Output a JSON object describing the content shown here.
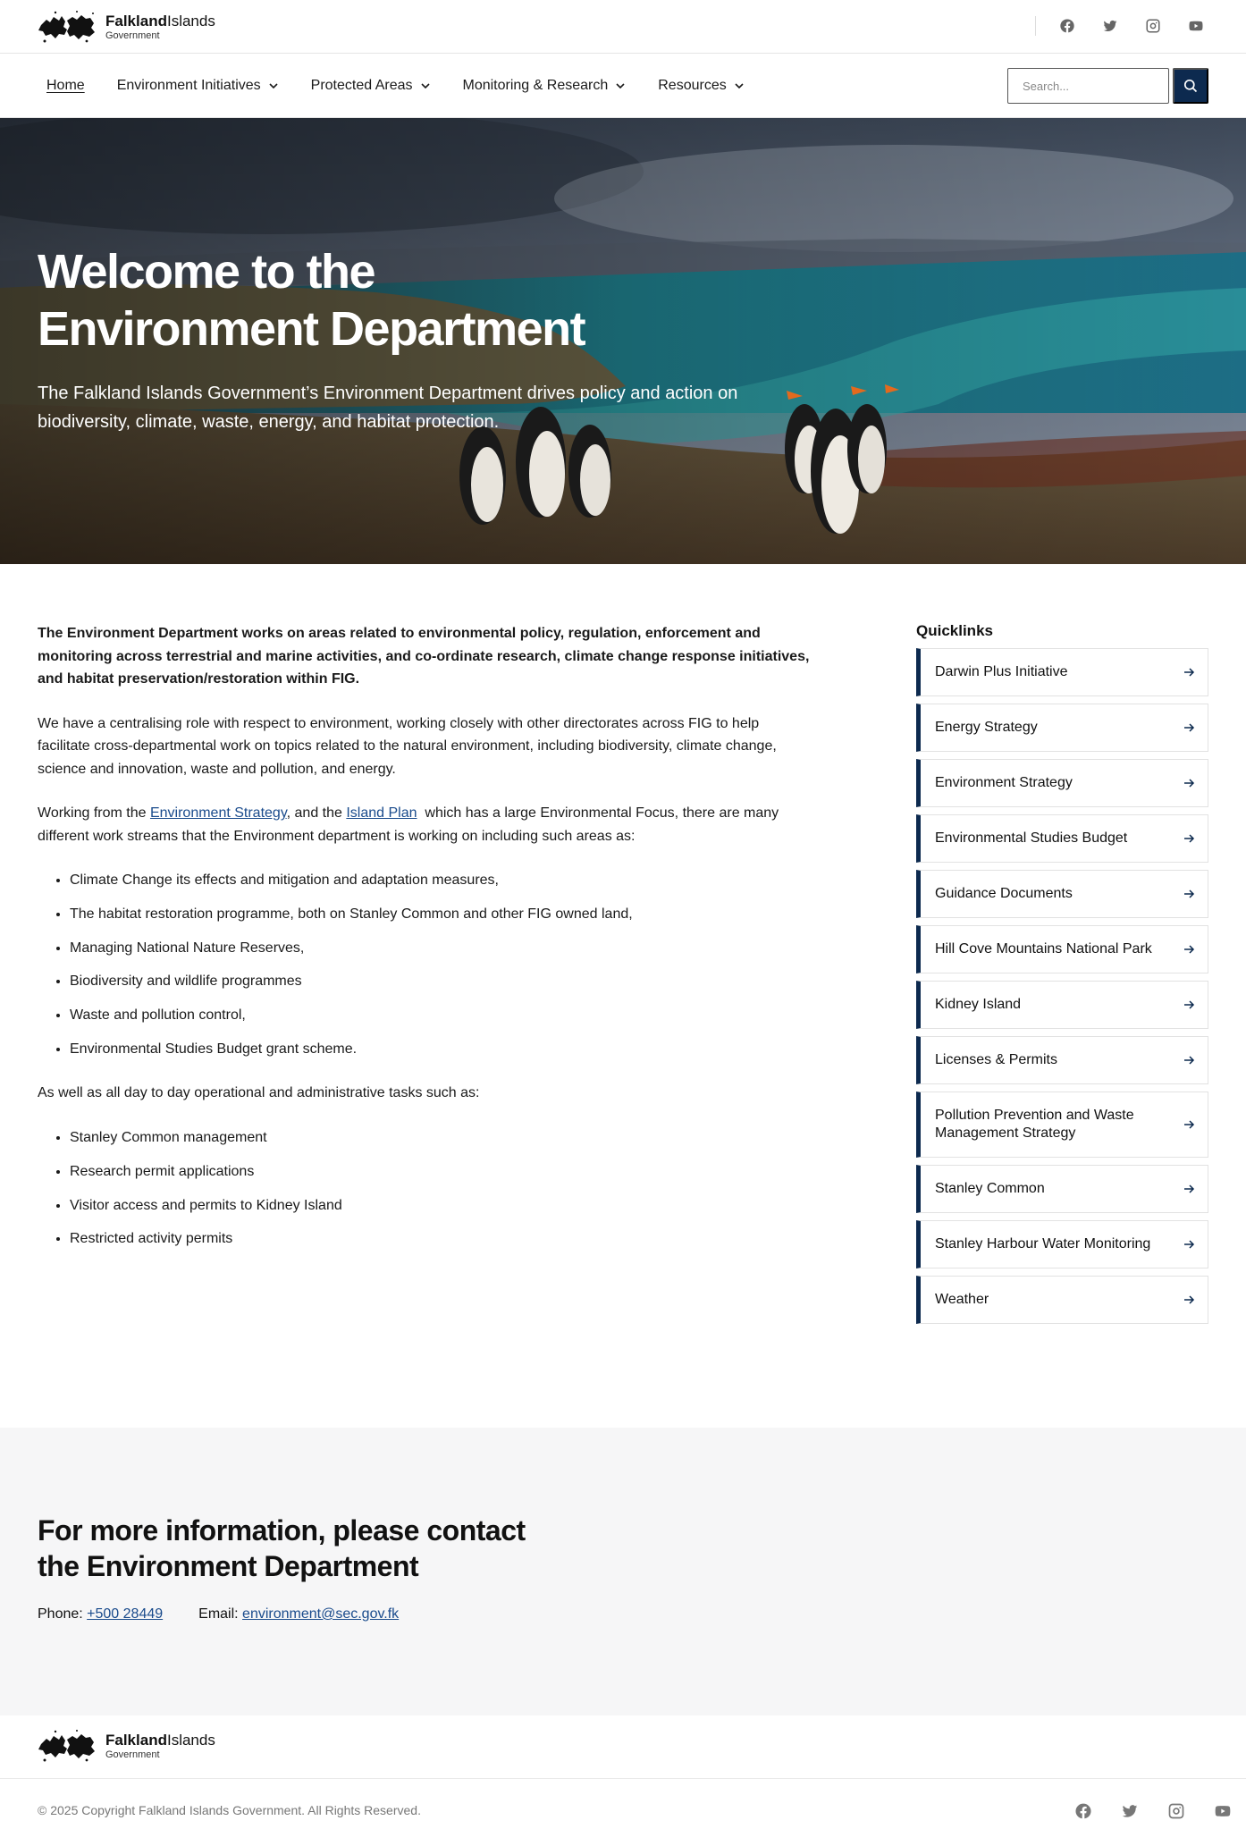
{
  "brand": {
    "name_bold": "Falkland",
    "name_rest": "Islands",
    "sub": "Government"
  },
  "social": [
    "facebook-icon",
    "twitter-icon",
    "instagram-icon",
    "youtube-icon"
  ],
  "nav": {
    "items": [
      {
        "label": "Home"
      },
      {
        "label": "Environment Initiatives"
      },
      {
        "label": "Protected Areas"
      },
      {
        "label": "Monitoring & Research"
      },
      {
        "label": "Resources"
      }
    ],
    "search_placeholder": "Search..."
  },
  "hero": {
    "title_line1": "Welcome to the",
    "title_line2": "Environment Department",
    "subtitle": "The Falkland Islands Government’s Environment Department drives policy and action on biodiversity, climate, waste, energy, and habitat protection."
  },
  "main": {
    "lead": "The Environment Department works on areas related to environmental policy, regulation, enforcement and monitoring across terrestrial and marine activities, and co-ordinate research, climate change response initiatives, and habitat preservation/restoration within FIG.",
    "para2": "We have a centralising role with respect to environment, working closely with other directorates across FIG to help facilitate cross-departmental work on topics related to the natural environment, including biodiversity, climate change, science and innovation, waste and pollution, and energy.",
    "para3_prefix": "Working from the ",
    "link_strategy": "Environment Strategy",
    "para3_mid": ", and the ",
    "link_plan": "Island Plan",
    "para3_suffix": "  which has a large Environmental Focus, there are many different work streams that the Environment department is working on including such areas as:",
    "list1": [
      "Climate Change its effects and mitigation and adaptation measures,",
      "The habitat restoration programme, both on Stanley Common and other FIG owned land,",
      "Managing National Nature Reserves,",
      "Biodiversity and wildlife programmes",
      "Waste and pollution control,",
      "Environmental Studies Budget grant scheme."
    ],
    "para4": "As well as all day to day operational and administrative tasks such as:",
    "list2": [
      "Stanley Common management",
      "Research permit applications",
      "Visitor access and permits to Kidney Island",
      "Restricted activity permits"
    ]
  },
  "quicklinks": {
    "title": "Quicklinks",
    "items": [
      "Darwin Plus Initiative",
      "Energy Strategy",
      "Environment Strategy",
      "Environmental Studies Budget",
      "Guidance Documents",
      "Hill Cove Mountains National Park",
      "Kidney Island",
      "Licenses & Permits",
      "Pollution Prevention and Waste Management Strategy",
      "Stanley Common",
      "Stanley Harbour Water Monitoring",
      "Weather"
    ]
  },
  "contact": {
    "title": "For more information, please contact the Environment Department",
    "phone_label": "Phone: ",
    "phone": "+500 28449",
    "email_label": "Email: ",
    "email": "environment@sec.gov.fk"
  },
  "footer": {
    "copyright": "© 2025 Copyright Falkland Islands Government. All Rights Reserved."
  },
  "colors": {
    "accent": "#0d2a4f",
    "link": "#1a4b8c",
    "contact_bg": "#f6f6f7"
  }
}
